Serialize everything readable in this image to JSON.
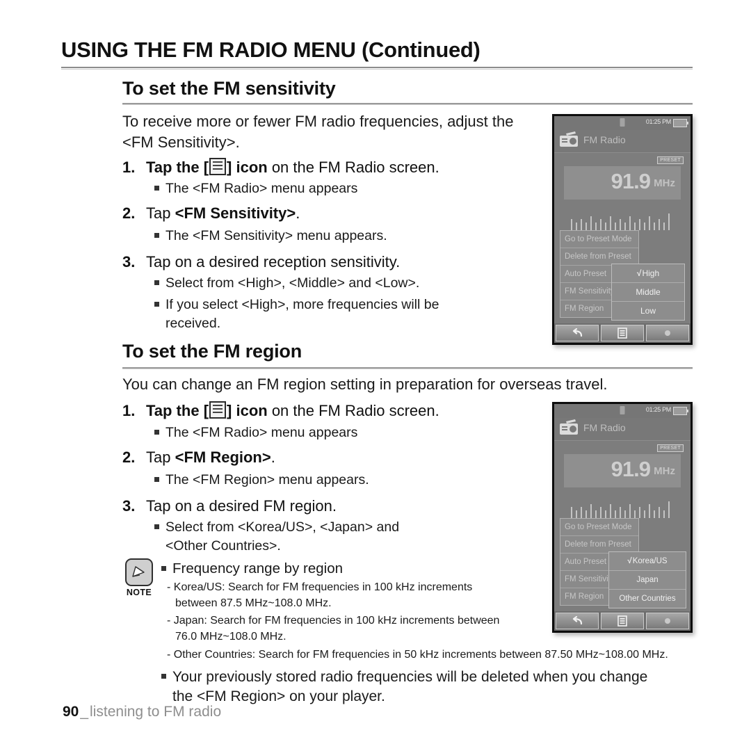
{
  "chapter": {
    "title": "USING THE FM RADIO MENU (Continued)"
  },
  "section1": {
    "title": "To set the FM sensitivity",
    "intro": "To receive more or fewer FM radio frequencies, adjust the <FM Sensitivity>.",
    "step1_pre": "Tap the [",
    "step1_post": "] icon",
    "step1_tail": " on the FM Radio screen.",
    "step1_bullet": "The <FM Radio> menu appears",
    "step2_pre": "Tap ",
    "step2_bold": "<FM Sensitivity>",
    "step2_post": ".",
    "step2_bullet": "The <FM Sensitivity> menu appears.",
    "step3": "Tap on a desired reception sensitivity.",
    "step3_bullet1": "Select from <High>, <Middle> and <Low>.",
    "step3_bullet2": "If you select <High>, more frequencies will be",
    "step3_bullet2_cont": "received."
  },
  "section2": {
    "title": "To set the FM region",
    "intro": "You can change an FM region setting in preparation for overseas travel.",
    "step1_pre": "Tap the [",
    "step1_post": "] icon",
    "step1_tail": " on the FM Radio screen.",
    "step1_bullet": "The <FM Radio> menu appears",
    "step2_pre": "Tap ",
    "step2_bold": "<FM Region>",
    "step2_post": ".",
    "step2_bullet": "The <FM Region> menu appears.",
    "step3": "Tap on a desired FM region.",
    "step3_bullet1": "Select from <Korea/US>, <Japan> and",
    "step3_bullet1_cont": "<Other Countries>."
  },
  "note": {
    "label": "NOTE",
    "heading": "Frequency range by region",
    "line1": "- Korea/US: Search for FM frequencies in 100 kHz increments",
    "line1_cont": "between 87.5 MHz~108.0 MHz.",
    "line2": "- Japan: Search for FM frequencies in 100 kHz increments between",
    "line2_cont": "76.0 MHz~108.0 MHz.",
    "line3": "- Other Countries: Search for FM frequencies in 50 kHz increments between 87.50 MHz~108.00 MHz.",
    "final_bullet": "Your previously stored radio frequencies will be deleted when you change",
    "final_bullet_cont": "the <FM Region> on your player."
  },
  "footer": {
    "page": "90",
    "sep": "_",
    "text": "listening to FM radio"
  },
  "device1": {
    "time": "01:25 PM",
    "title": "FM Radio",
    "preset": "PRESET",
    "frequency": "91.9",
    "unit": "MHz",
    "menu_items": [
      "Go to Preset Mode",
      "Delete from Preset",
      "Auto Preset",
      "FM Sensitivity",
      "FM Region"
    ],
    "submenu_items": [
      "High",
      "Middle",
      "Low"
    ],
    "submenu_checked": "High",
    "check_mark": "√"
  },
  "device2": {
    "time": "01:25 PM",
    "title": "FM Radio",
    "preset": "PRESET",
    "frequency": "91.9",
    "unit": "MHz",
    "menu_items": [
      "Go to Preset Mode",
      "Delete from Preset",
      "Auto Preset",
      "FM Sensitivity",
      "FM Region"
    ],
    "submenu_items": [
      "Korea/US",
      "Japan",
      "Other Countries"
    ],
    "submenu_checked": "Korea/US",
    "check_mark": "√"
  }
}
